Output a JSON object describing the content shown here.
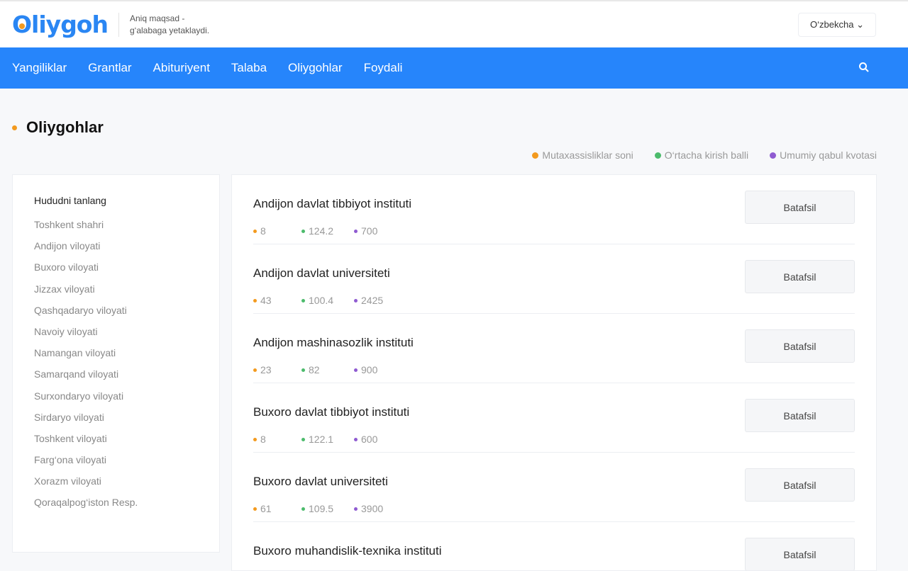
{
  "header": {
    "logo": "Oliygoh",
    "tagline1": "Aniq maqsad -",
    "tagline2": "g‘alabaga yetaklaydi.",
    "language": "O‘zbekcha"
  },
  "nav": [
    "Yangiliklar",
    "Grantlar",
    "Abituriyent",
    "Talaba",
    "Oliygohlar",
    "Foydali"
  ],
  "page_title": "Oliygohlar",
  "colors": {
    "orange": "#f39a1e",
    "green": "#4cbb6c",
    "purple": "#8f5bd1",
    "brand": "#2685fb"
  },
  "legend": [
    "Mutaxassisliklar soni",
    "O‘rtacha kirish balli",
    "Umumiy qabul kvotasi"
  ],
  "sidebar": {
    "heading": "Hududni tanlang",
    "regions": [
      "Toshkent shahri",
      "Andijon viloyati",
      "Buxoro viloyati",
      "Jizzax viloyati",
      "Qashqadaryo viloyati",
      "Navoiy viloyati",
      "Namangan viloyati",
      "Samarqand viloyati",
      "Surxondaryo viloyati",
      "Sirdaryo viloyati",
      "Toshkent viloyati",
      "Farg‘ona viloyati",
      "Xorazm viloyati",
      "Qoraqalpog‘iston Resp."
    ]
  },
  "button_label": "Batafsil",
  "universities": [
    {
      "name": "Andijon davlat tibbiyot instituti",
      "specialties": "8",
      "avg_score": "124.2",
      "quota": "700"
    },
    {
      "name": "Andijon davlat universiteti",
      "specialties": "43",
      "avg_score": "100.4",
      "quota": "2425"
    },
    {
      "name": "Andijon mashinasozlik instituti",
      "specialties": "23",
      "avg_score": "82",
      "quota": "900"
    },
    {
      "name": "Buxoro davlat tibbiyot instituti",
      "specialties": "8",
      "avg_score": "122.1",
      "quota": "600"
    },
    {
      "name": "Buxoro davlat universiteti",
      "specialties": "61",
      "avg_score": "109.5",
      "quota": "3900"
    },
    {
      "name": "Buxoro muhandislik-texnika instituti",
      "specialties": "",
      "avg_score": "",
      "quota": ""
    }
  ]
}
